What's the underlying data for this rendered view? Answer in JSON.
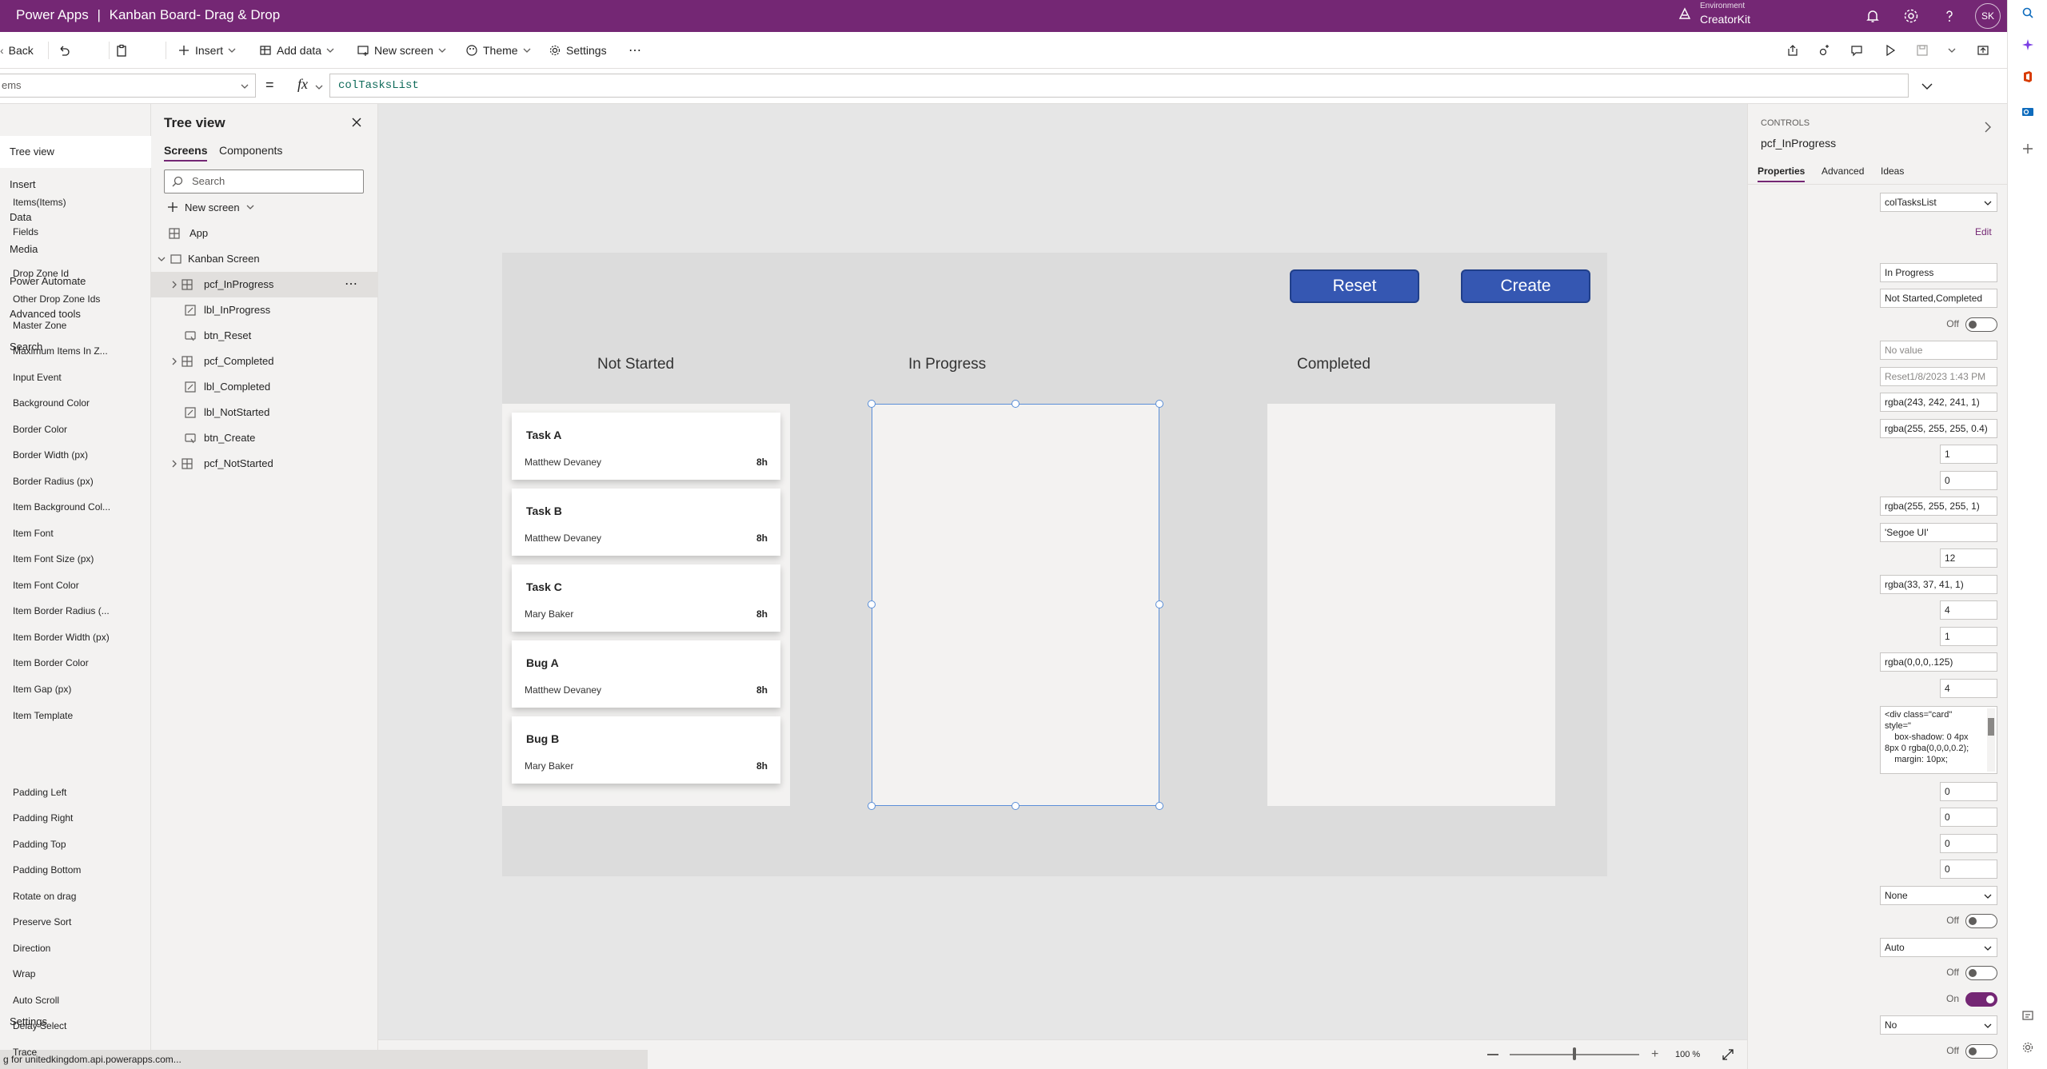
{
  "titlebar": {
    "app_name": "Power Apps",
    "separator": "|",
    "doc_title": "Kanban Board- Drag & Drop",
    "env_label": "Environment",
    "env_value": "CreatorKit",
    "avatar": "SK"
  },
  "cmdbar": {
    "back": "Back",
    "insert": "Insert",
    "add_data": "Add data",
    "new_screen": "New screen",
    "theme": "Theme",
    "settings": "Settings",
    "more": "⋯"
  },
  "formulabar": {
    "property": "ems",
    "equals": "=",
    "fx": "fx",
    "formula": "colTasksList"
  },
  "leftnav": {
    "items": [
      "Tree view",
      "Insert",
      "Data",
      "Media",
      "Power Automate",
      "Advanced tools",
      "Search"
    ],
    "settings": "Settings"
  },
  "treeview": {
    "title": "Tree view",
    "tabs": [
      "Screens",
      "Components"
    ],
    "search_placeholder": "Search",
    "new_screen": "New screen",
    "app": "App",
    "screen": "Kanban Screen",
    "controls": [
      "pcf_InProgress",
      "lbl_InProgress",
      "btn_Reset",
      "pcf_Completed",
      "lbl_Completed",
      "lbl_NotStarted",
      "btn_Create",
      "pcf_NotStarted"
    ],
    "more": "⋯"
  },
  "canvas": {
    "reset_label": "Reset",
    "create_label": "Create",
    "columns": [
      "Not Started",
      "In Progress",
      "Completed"
    ],
    "cards": [
      {
        "title": "Task A",
        "assignee": "Matthew Devaney",
        "hours": "8h"
      },
      {
        "title": "Task B",
        "assignee": "Matthew Devaney",
        "hours": "8h"
      },
      {
        "title": "Task C",
        "assignee": "Mary Baker",
        "hours": "8h"
      },
      {
        "title": "Bug A",
        "assignee": "Matthew Devaney",
        "hours": "8h"
      },
      {
        "title": "Bug B",
        "assignee": "Mary Baker",
        "hours": "8h"
      }
    ]
  },
  "zoom": {
    "value": "100 %",
    "level": 0.5
  },
  "status": "g for unitedkingdom.api.powerapps.com...",
  "props": {
    "section": "CONTROLS",
    "control_name": "pcf_InProgress",
    "tabs": [
      "Properties",
      "Advanced",
      "Ideas"
    ],
    "items_label": "Items(Items)",
    "items_value": "colTasksList",
    "fields_label": "Fields",
    "edit_label": "Edit",
    "drop_zone_id_label": "Drop Zone Id",
    "drop_zone_id": "In Progress",
    "other_zone_label": "Other Drop Zone Ids",
    "other_zone": "Not Started,Completed",
    "master_zone_label": "Master Zone",
    "master_zone": "Off",
    "max_items_label": "Maximum Items In Z...",
    "max_items": "No value",
    "input_event_label": "Input Event",
    "input_event": "Reset1/8/2023 1:43 PM",
    "bg_color_label": "Background Color",
    "bg_color": "rgba(243, 242, 241, 1)",
    "border_color_label": "Border Color",
    "border_color": "rgba(255, 255, 255, 0.4)",
    "border_width_label": "Border Width (px)",
    "border_width": "1",
    "border_radius_label": "Border Radius (px)",
    "border_radius": "0",
    "item_bg_label": "Item Background Col...",
    "item_bg": "rgba(255, 255, 255, 1)",
    "item_font_label": "Item Font",
    "item_font": "'Segoe UI'",
    "item_font_size_label": "Item Font Size (px)",
    "item_font_size": "12",
    "item_font_color_label": "Item Font Color",
    "item_font_color": "rgba(33, 37, 41, 1)",
    "item_border_radius_label": "Item Border Radius (...",
    "item_border_radius": "4",
    "item_border_width_label": "Item Border Width (px)",
    "item_border_width": "1",
    "item_border_color_label": "Item Border Color",
    "item_border_color": "rgba(0,0,0,.125)",
    "item_gap_label": "Item Gap (px)",
    "item_gap": "4",
    "item_template_label": "Item Template",
    "item_template_lines": [
      "<div class=\"card\"",
      "style=\"",
      "    box-shadow: 0 4px",
      "8px 0 rgba(0,0,0,0.2);",
      "    margin: 10px;"
    ],
    "padding_left_label": "Padding Left",
    "padding_left": "0",
    "padding_right_label": "Padding Right",
    "padding_right": "0",
    "padding_top_label": "Padding Top",
    "padding_top": "0",
    "padding_bottom_label": "Padding Bottom",
    "padding_bottom": "0",
    "rotate_label": "Rotate on drag",
    "rotate": "None",
    "preserve_sort_label": "Preserve Sort",
    "preserve_sort": "Off",
    "direction_label": "Direction",
    "direction": "Auto",
    "wrap_label": "Wrap",
    "wrap": "Off",
    "auto_scroll_label": "Auto Scroll",
    "auto_scroll": "On",
    "delay_select_label": "Delay Select",
    "delay_select": "No",
    "trace_label": "Trace",
    "trace": "Off"
  },
  "colors": {
    "brand": "#742774",
    "button": "#3557b2",
    "selection": "#5b8fd8"
  }
}
